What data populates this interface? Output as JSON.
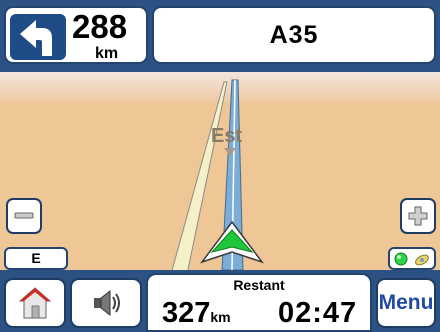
{
  "navigation": {
    "next_turn_distance": "288",
    "next_turn_unit": "km",
    "road_name": "A35"
  },
  "map": {
    "compass_label": "Est"
  },
  "status": {
    "heading": "E"
  },
  "remaining": {
    "label": "Restant",
    "distance": "327",
    "distance_unit": "km",
    "time": "02:47"
  },
  "controls": {
    "menu_label": "Menu"
  },
  "colors": {
    "frame": "#2b5283",
    "map_ground": "#efc796",
    "sky": "#f0dccb",
    "route": "#6f9fd0",
    "accent_green": "#1fc73a"
  },
  "icons": [
    "turn-left-arrow-icon",
    "zoom-out-icon",
    "zoom-in-icon",
    "gps-signal-icon",
    "satellite-icon",
    "home-icon",
    "speaker-icon",
    "vehicle-position-icon"
  ]
}
